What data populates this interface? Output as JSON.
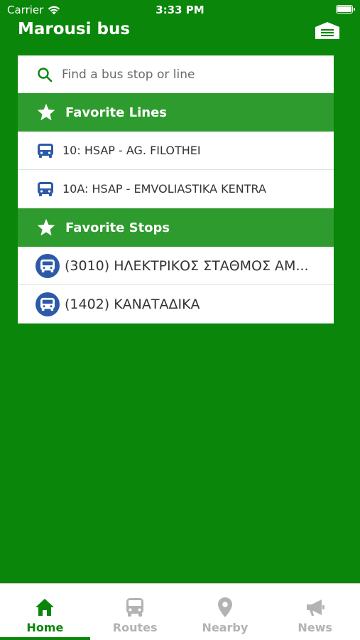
{
  "status_bar": {
    "carrier": "Carrier",
    "time": "3:33 PM"
  },
  "header": {
    "title": "Marousi bus"
  },
  "search": {
    "placeholder": "Find a bus stop or line"
  },
  "favorite_lines": {
    "title": "Favorite Lines",
    "items": [
      {
        "label": "10: HSAP - AG. FILOTHEI"
      },
      {
        "label": "10A: HSAP - EMVOLIASTIKA KENTRA"
      }
    ]
  },
  "favorite_stops": {
    "title": "Favorite Stops",
    "items": [
      {
        "label": "(3010) ΗΛΕΚΤΡΙΚΟΣ ΣΤΑΘΜΟΣ ΑΜ..."
      },
      {
        "label": "(1402) ΚΑΝΑΤΑΔΙΚΑ"
      }
    ]
  },
  "tabs": [
    {
      "label": "Home",
      "icon": "home-icon",
      "active": true
    },
    {
      "label": "Routes",
      "icon": "bus-icon",
      "active": false
    },
    {
      "label": "Nearby",
      "icon": "map-pin-icon",
      "active": false
    },
    {
      "label": "News",
      "icon": "megaphone-icon",
      "active": false
    }
  ],
  "colors": {
    "brand_green": "#0a860a",
    "section_green": "#2e9b2e",
    "bus_blue": "#2d5aa8",
    "inactive_tab": "#b3b3b3"
  }
}
